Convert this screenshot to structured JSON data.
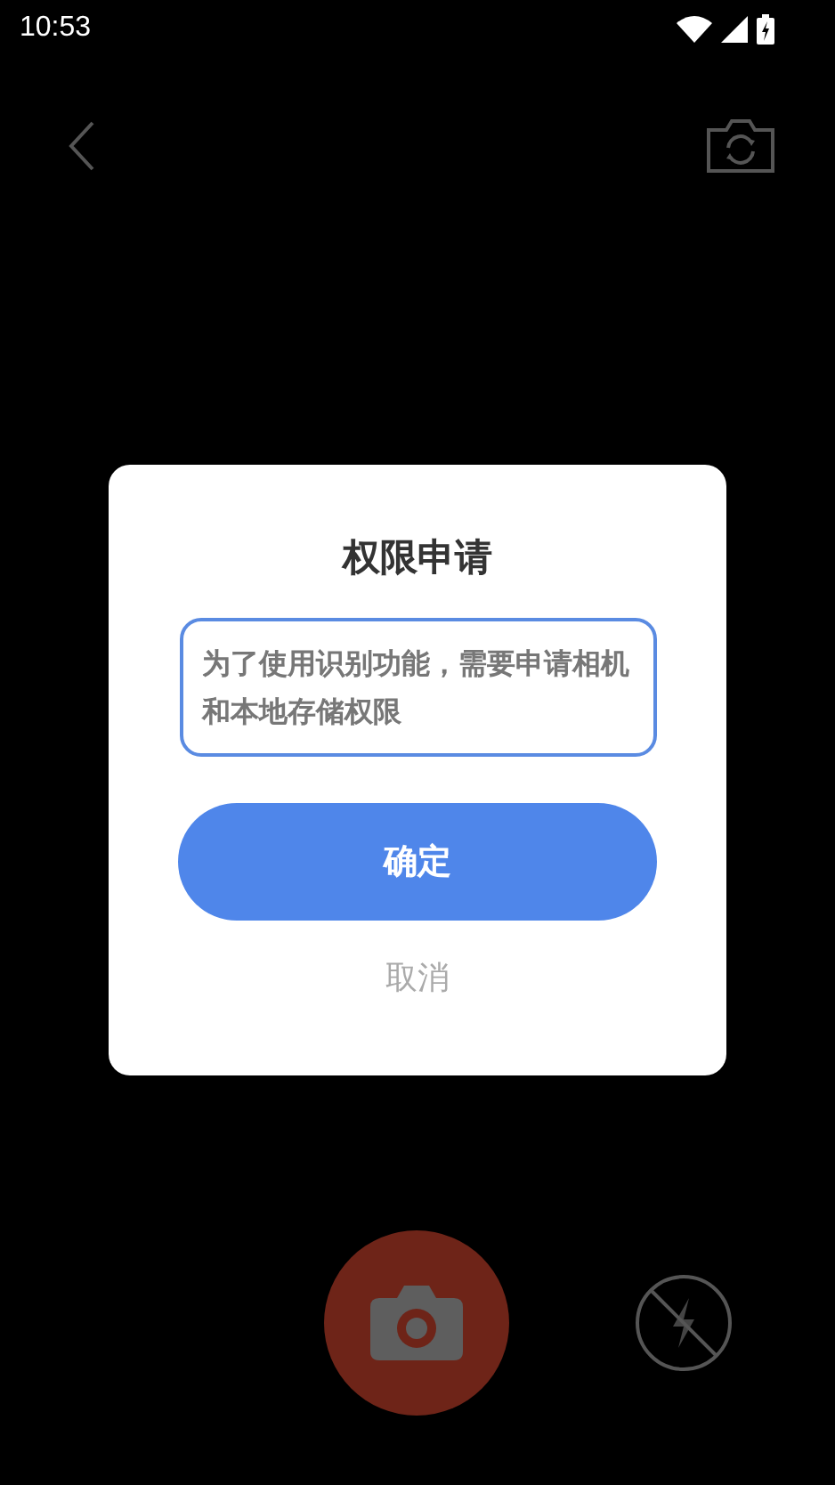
{
  "status_bar": {
    "time": "10:53"
  },
  "dialog": {
    "title": "权限申请",
    "message": "为了使用识别功能，需要申请相机和本地存储权限",
    "confirm": "确定",
    "cancel": "取消"
  }
}
